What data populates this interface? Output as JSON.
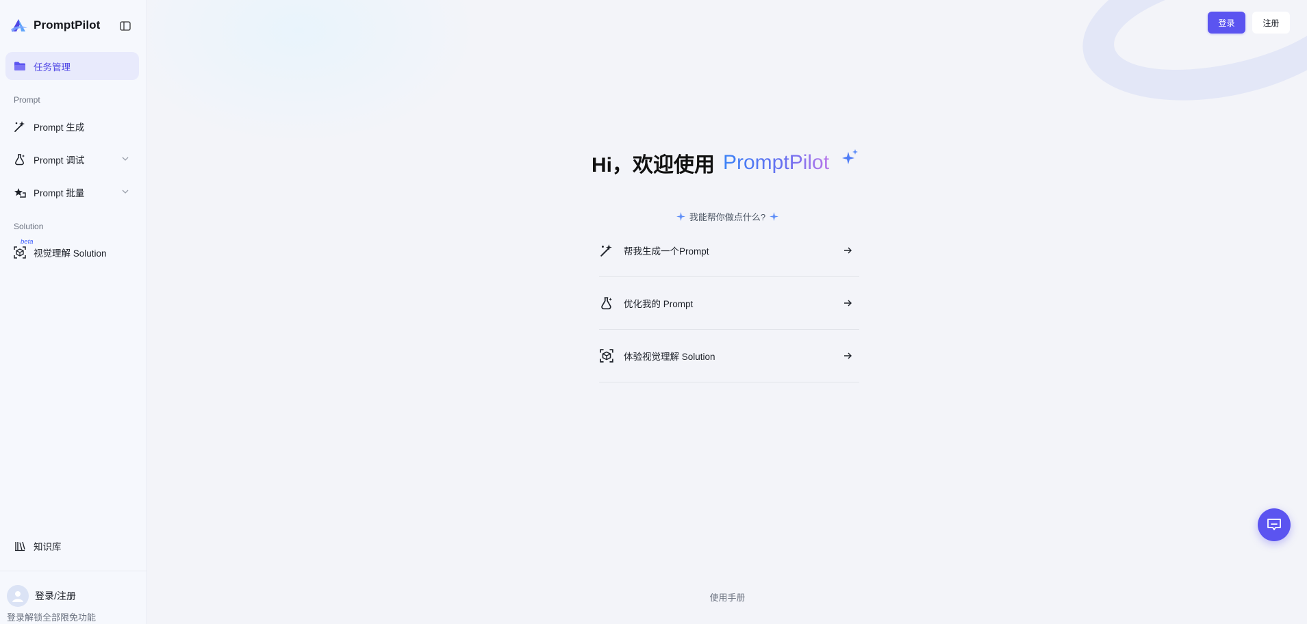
{
  "brand": {
    "name": "PromptPilot"
  },
  "sidebar": {
    "task_management": "任务管理",
    "sections": [
      {
        "label": "Prompt"
      },
      {
        "label": "Solution"
      }
    ],
    "items": [
      {
        "label": "Prompt 生成",
        "icon": "magic-wand-icon"
      },
      {
        "label": "Prompt 调试",
        "icon": "flask-icon"
      },
      {
        "label": "Prompt 批量",
        "icon": "batch-stars-icon"
      },
      {
        "label": "视觉理解 Solution",
        "icon": "cube-scan-icon",
        "badge": "beta"
      }
    ],
    "knowledge_base": "知识库",
    "login_link": "登录/注册",
    "login_hint": "登录解锁全部限免功能"
  },
  "header": {
    "login_button": "登录",
    "register_button": "注册"
  },
  "hero": {
    "greeting": "Hi，欢迎使用",
    "brand": "PromptPilot",
    "subtitle": "我能帮你做点什么?"
  },
  "suggestions": [
    {
      "label": "帮我生成一个Prompt",
      "icon": "magic-wand-icon"
    },
    {
      "label": "优化我的 Prompt",
      "icon": "flask-icon"
    },
    {
      "label": "体验视觉理解 Solution",
      "icon": "cube-scan-icon"
    }
  ],
  "footer": {
    "manual": "使用手册"
  },
  "colors": {
    "accent": "#5b54f0",
    "active_bg": "#e8eafc",
    "active_text": "#4f46e5",
    "sparkle": "#4f7cf6"
  }
}
